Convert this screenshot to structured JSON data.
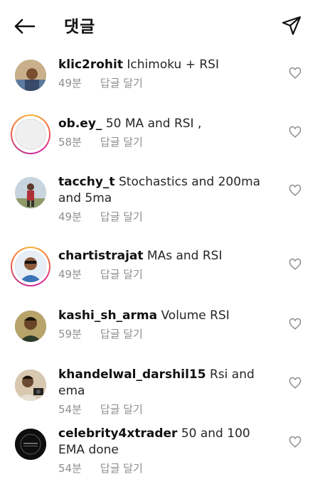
{
  "header": {
    "title": "댓글",
    "back_icon": "arrow-left-icon",
    "send_icon": "paper-plane-icon"
  },
  "comments": [
    {
      "username": "klic2rohit",
      "text": "Ichimoku + RSI",
      "time": "49분",
      "reply": "답글 달기",
      "story_ring": false,
      "avatar_color": "#8a6a4a"
    },
    {
      "username": "ob.ey_",
      "text": "50 MA and RSI ,",
      "time": "58분",
      "reply": "답글 달기",
      "story_ring": true,
      "avatar_color": "#efefef"
    },
    {
      "username": "tacchy_t",
      "text": "Stochastics and 200ma and 5ma",
      "time": "49분",
      "reply": "답글 달기",
      "story_ring": false,
      "avatar_color": "#b8c6d6"
    },
    {
      "username": "chartistrajat",
      "text": "MAs and RSI",
      "time": "49분",
      "reply": "답글 달기",
      "story_ring": true,
      "avatar_color": "#3c74b8"
    },
    {
      "username": "kashi_sh_arma",
      "text": "Volume RSI",
      "time": "59분",
      "reply": "답글 달기",
      "story_ring": false,
      "avatar_color": "#6b5a3a"
    },
    {
      "username": "khandelwal_darshil15",
      "text": "Rsi and ema",
      "time": "54분",
      "reply": "답글 달기",
      "story_ring": false,
      "avatar_color": "#9a7b62"
    },
    {
      "username": "celebrity4xtrader",
      "text": "50 and 100 EMA done",
      "time": "54분",
      "reply": "답글 달기",
      "story_ring": false,
      "avatar_color": "#111111"
    }
  ],
  "colors": {
    "text": "#262626",
    "meta": "#8e8e8e",
    "background": "#ffffff"
  }
}
